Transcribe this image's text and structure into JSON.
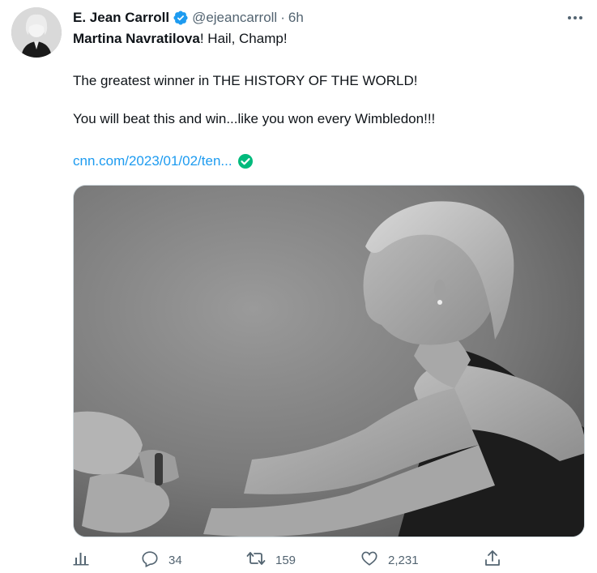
{
  "tweet": {
    "author_name": "E. Jean Carroll",
    "handle": "@ejeancarroll",
    "separator": "·",
    "time": "6h",
    "body": {
      "mention_name": "Martina Navratilova",
      "line1_rest": "! Hail, Champ!",
      "line2": "The greatest winner in THE HISTORY OF THE WORLD!",
      "line3": "You will beat this and win...like you won every Wimbledon!!!",
      "link_text": "cnn.com/2023/01/02/ten..."
    },
    "media": {
      "description_icon": "photo"
    },
    "actions": {
      "analytics_icon": "analytics-icon",
      "reply_count": "34",
      "retweet_count": "159",
      "like_count": "2,231",
      "share_icon": "share-icon"
    }
  },
  "colors": {
    "accent": "#1d9bf0",
    "secondary_text": "#536471",
    "verified_green": "#00ba7c"
  }
}
